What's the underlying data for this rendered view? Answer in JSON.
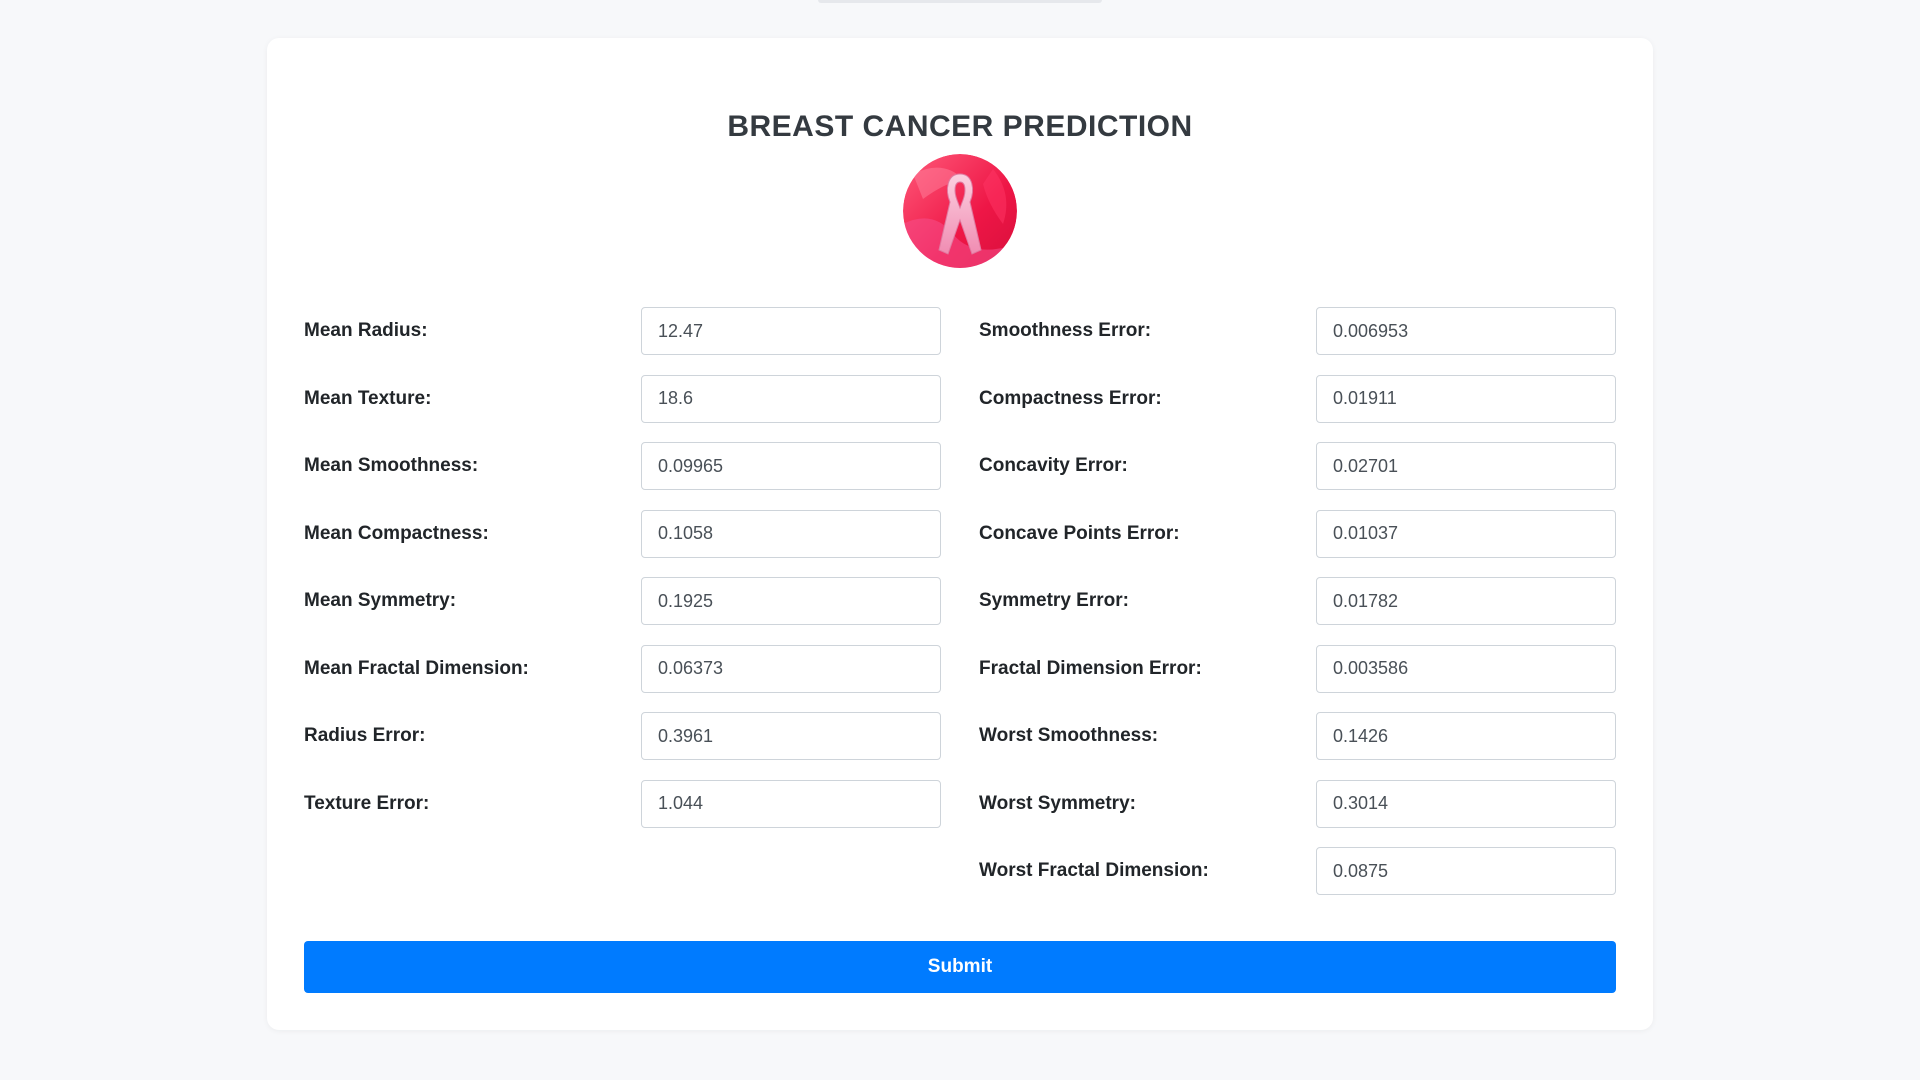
{
  "page": {
    "title": "BREAST CANCER PREDICTION",
    "logo_icon": "pink-ribbon-icon",
    "colors": {
      "background": "#f7f8fa",
      "card": "#ffffff",
      "accent": "#007bff",
      "logo_primary": "#e8174a",
      "logo_ribbon": "#f7a8c4"
    }
  },
  "form": {
    "left_fields": [
      {
        "label": "Mean Radius:",
        "value": "12.47"
      },
      {
        "label": "Mean Texture:",
        "value": "18.6"
      },
      {
        "label": "Mean Smoothness:",
        "value": "0.09965"
      },
      {
        "label": "Mean Compactness:",
        "value": "0.1058"
      },
      {
        "label": "Mean Symmetry:",
        "value": "0.1925"
      },
      {
        "label": "Mean Fractal Dimension:",
        "value": "0.06373"
      },
      {
        "label": "Radius Error:",
        "value": "0.3961"
      },
      {
        "label": "Texture Error:",
        "value": "1.044"
      }
    ],
    "right_fields": [
      {
        "label": "Smoothness Error:",
        "value": "0.006953"
      },
      {
        "label": "Compactness Error:",
        "value": "0.01911"
      },
      {
        "label": "Concavity Error:",
        "value": "0.02701"
      },
      {
        "label": "Concave Points Error:",
        "value": "0.01037"
      },
      {
        "label": "Symmetry Error:",
        "value": "0.01782"
      },
      {
        "label": "Fractal Dimension Error:",
        "value": "0.003586"
      },
      {
        "label": "Worst Smoothness:",
        "value": "0.1426"
      },
      {
        "label": "Worst Symmetry:",
        "value": "0.3014"
      },
      {
        "label": "Worst Fractal Dimension:",
        "value": "0.0875"
      }
    ],
    "submit_label": "Submit"
  }
}
